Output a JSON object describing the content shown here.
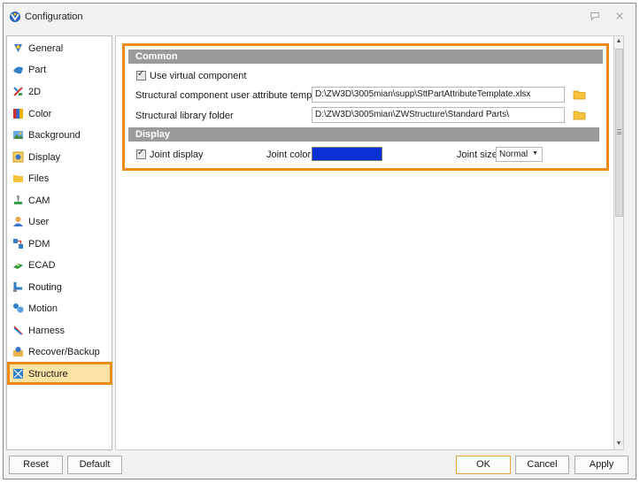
{
  "window": {
    "title": "Configuration"
  },
  "sidebar": {
    "items": [
      {
        "label": "General",
        "icon": "general-icon"
      },
      {
        "label": "Part",
        "icon": "part-icon"
      },
      {
        "label": "2D",
        "icon": "2d-icon"
      },
      {
        "label": "Color",
        "icon": "color-icon"
      },
      {
        "label": "Background",
        "icon": "background-icon"
      },
      {
        "label": "Display",
        "icon": "display-icon"
      },
      {
        "label": "Files",
        "icon": "folder-icon"
      },
      {
        "label": "CAM",
        "icon": "cam-icon"
      },
      {
        "label": "User",
        "icon": "user-icon"
      },
      {
        "label": "PDM",
        "icon": "pdm-icon"
      },
      {
        "label": "ECAD",
        "icon": "ecad-icon"
      },
      {
        "label": "Routing",
        "icon": "routing-icon"
      },
      {
        "label": "Motion",
        "icon": "motion-icon"
      },
      {
        "label": "Harness",
        "icon": "harness-icon"
      },
      {
        "label": "Recover/Backup",
        "icon": "recover-icon"
      },
      {
        "label": "Structure",
        "icon": "structure-icon",
        "selected": true
      }
    ]
  },
  "common": {
    "heading": "Common",
    "use_virtual_component": {
      "label": "Use virtual component",
      "checked": true
    },
    "attribute_template": {
      "label": "Structural component user attribute template",
      "value": "D:\\ZW3D\\3005mian\\supp\\SttPartAttributeTemplate.xlsx"
    },
    "library_folder": {
      "label": "Structural library folder",
      "value": "D:\\ZW3D\\3005mian\\ZWStructure\\Standard Parts\\"
    }
  },
  "display": {
    "heading": "Display",
    "joint_display": {
      "label": "Joint display",
      "checked": true
    },
    "joint_color": {
      "label": "Joint color",
      "value": "#0a32d6"
    },
    "joint_size": {
      "label": "Joint size",
      "selected": "Normal"
    }
  },
  "footer": {
    "reset": "Reset",
    "default": "Default",
    "ok": "OK",
    "cancel": "Cancel",
    "apply": "Apply"
  },
  "colors": {
    "highlight": "#f08c15",
    "selected_bg": "#fbe3a4",
    "section_bar": "#9b9b9b"
  }
}
